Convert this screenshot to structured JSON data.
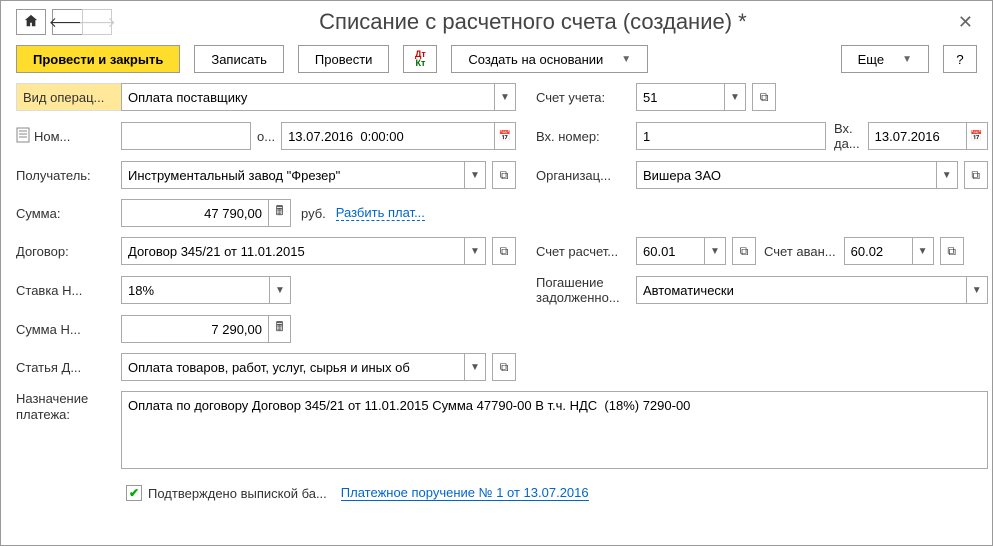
{
  "title": "Списание с расчетного счета (создание) *",
  "toolbar": {
    "post_close": "Провести и закрыть",
    "save": "Записать",
    "post": "Провести",
    "based_on": "Создать на основании",
    "more": "Еще"
  },
  "labels": {
    "operation_type": "Вид операц...",
    "number": "Ном...",
    "from": "о...",
    "recipient": "Получатель:",
    "amount": "Сумма:",
    "currency": "руб.",
    "split_payment": "Разбить плат...",
    "contract": "Договор:",
    "vat_rate": "Ставка Н...",
    "vat_amount": "Сумма Н...",
    "dds_item": "Статья Д...",
    "purpose": "Назначение\nплатежа:",
    "account": "Счет учета:",
    "in_number": "Вх. номер:",
    "in_date": "Вх. да...",
    "organization": "Организац...",
    "settlement_account": "Счет расчет...",
    "advance_account": "Счет аван...",
    "debt_repayment": "Погашение\nзадолженно...",
    "confirmed": "Подтверждено выпиской ба...",
    "payment_order_link": "Платежное поручение № 1 от 13.07.2016"
  },
  "values": {
    "operation_type": "Оплата поставщику",
    "number": "",
    "date": "13.07.2016  0:00:00",
    "recipient": "Инструментальный завод \"Фрезер\"",
    "amount": "47 790,00",
    "contract": "Договор 345/21 от 11.01.2015",
    "vat_rate": "18%",
    "vat_amount": "7 290,00",
    "dds_item": "Оплата товаров, работ, услуг, сырья и иных об",
    "purpose": "Оплата по договору Договор 345/21 от 11.01.2015 Сумма 47790-00 В т.ч. НДС  (18%) 7290-00",
    "account": "51",
    "in_number": "1",
    "in_date": "13.07.2016",
    "organization": "Вишера ЗАО",
    "settlement_account": "60.01",
    "advance_account": "60.02",
    "debt_repayment": "Автоматически"
  }
}
